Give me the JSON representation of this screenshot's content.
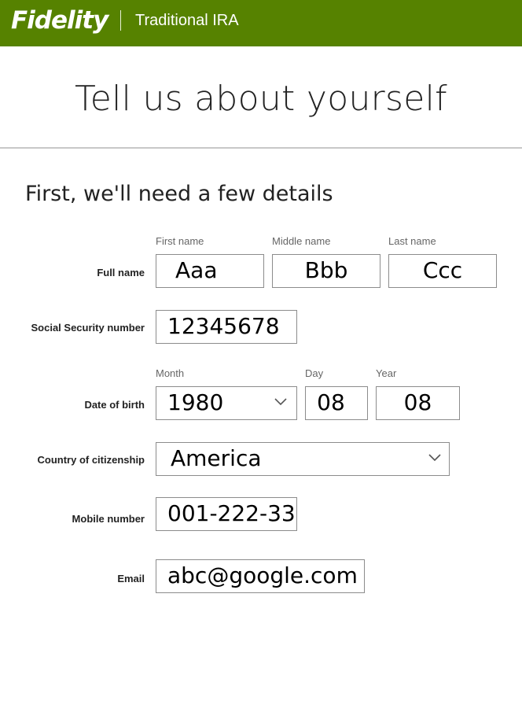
{
  "header": {
    "brand": "Fidelity",
    "product": "Traditional IRA"
  },
  "page_title": "Tell us about yourself",
  "section_title": "First, we'll need a few details",
  "form": {
    "full_name": {
      "label": "Full name",
      "first_label": "First name",
      "first_value": "Aaa",
      "middle_label": "Middle name",
      "middle_value": "Bbb",
      "last_label": "Last name",
      "last_value": "Ccc"
    },
    "ssn": {
      "label": "Social Security number",
      "value": "12345678"
    },
    "dob": {
      "label": "Date of birth",
      "month_label": "Month",
      "month_value": "1980",
      "day_label": "Day",
      "day_value": "08",
      "year_label": "Year",
      "year_value": "08"
    },
    "citizenship": {
      "label": "Country of citizenship",
      "value": "America"
    },
    "mobile": {
      "label": "Mobile number",
      "value": "001-222-33"
    },
    "email": {
      "label": "Email",
      "value": "abc@google.com"
    }
  },
  "colors": {
    "header_bg": "#568200",
    "divider": "#c8c8c8",
    "field_border": "#8c8c8c"
  },
  "icons": {
    "select_arrow": "chevron-down-icon"
  }
}
